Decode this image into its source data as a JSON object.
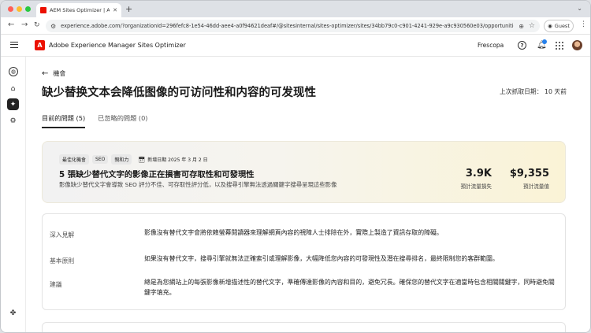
{
  "browser": {
    "tab_title": "AEM Sites Optimizer | Adobe",
    "url": "experience.adobe.com/?organizationId=296fefc8-1e54-46dd-aee4-a0f94621deaf#/@sitesinternal/sites-optimizer/sites/34bb79c0-c901-4241-929e-a9c930560e03/opportunities/9c7286c...",
    "guest_label": "Guest"
  },
  "header": {
    "app_title": "Adobe Experience Manager Sites Optimizer",
    "org_name": "Frescopa"
  },
  "page": {
    "back_label": "機會",
    "title": "缺少替换文本会降低图像的可访问性和内容的可发现性",
    "last_fetch": "上次抓取日期： 10 天前"
  },
  "tabs": [
    {
      "label": "目前的問題 (5)",
      "active": true
    },
    {
      "label": "已忽略的問題 (0)",
      "active": false
    }
  ],
  "summary": {
    "badges": [
      "最佳化機會",
      "SEO",
      "親和力"
    ],
    "date_badge": "新增日期 2025 年 3 月 2 日",
    "title": "5 張缺少替代文字的影像正在損害可存取性和可發現性",
    "description": "影像缺少替代文字會導致 SEO 評分不佳、可存取性評分低，以及搜尋引擎無法透過關鍵字搜尋呈現這些影像",
    "metrics": [
      {
        "value": "3.9K",
        "label": "預計流量損失"
      },
      {
        "value": "$9,355",
        "label": "預計流量值"
      }
    ]
  },
  "details": [
    {
      "label": "深入見解",
      "text": "影像沒有替代文字會將依賴螢幕閱讀器來理解網頁內容的視障人士排除在外，實際上製造了資訊存取的障礙。"
    },
    {
      "label": "基本原則",
      "text": "如果沒有替代文字，搜尋引擎就無法正確索引或理解影像，大幅降低您內容的可發現性及潛在搜尋排名，最終限制您的客群範圍。"
    },
    {
      "label": "建議",
      "text": "總是為您網站上的每張影像新增描述性的替代文字，準確傳達影像的內容和目的，避免冗長。確保您的替代文字在適當時包含相關關鍵字，同時避免關鍵字填充。"
    }
  ],
  "colors": {
    "accent_red": "#eb1000",
    "notification_blue": "#2680eb"
  },
  "icons": [
    "search-icon",
    "bell-icon",
    "help-icon",
    "apps-grid-icon",
    "globe-icon",
    "home-icon",
    "opportunities-icon",
    "gear-icon",
    "calendar-icon"
  ]
}
